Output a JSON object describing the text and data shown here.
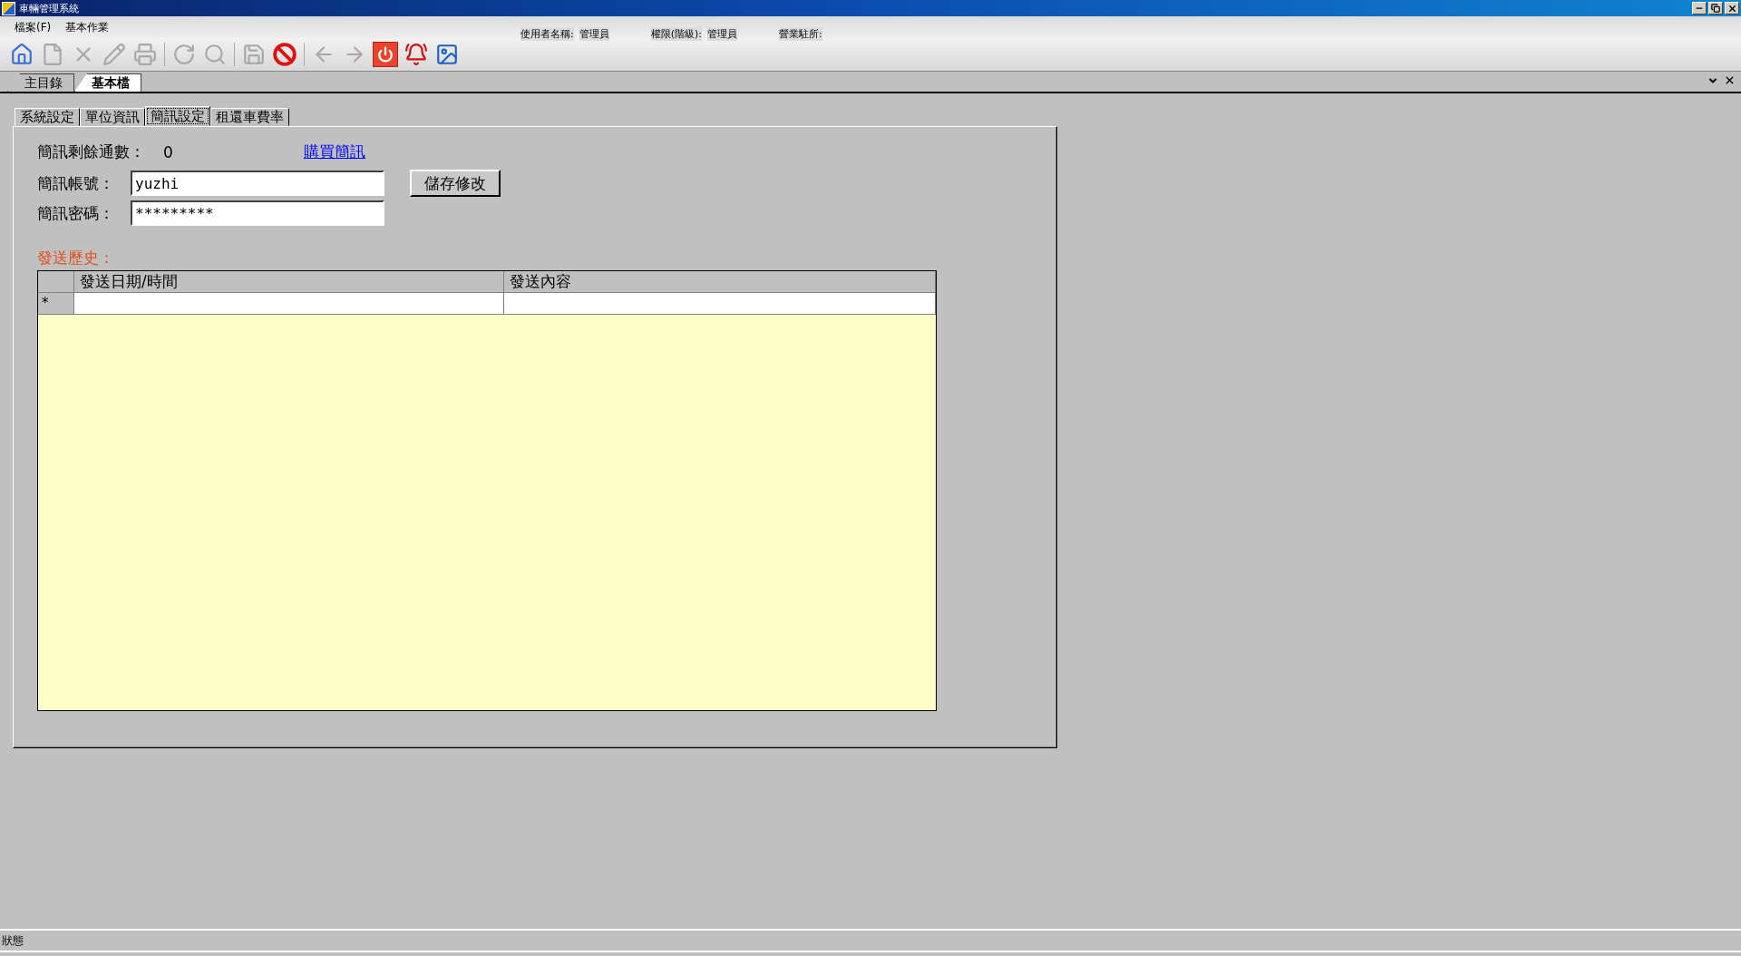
{
  "window": {
    "title": "車輛管理系統"
  },
  "menu": [
    "檔案(F)",
    "基本作業"
  ],
  "user_info": [
    {
      "label": "使用者名稱:",
      "value": "管理員"
    },
    {
      "label": "權限(階級):",
      "value": "管理員"
    },
    {
      "label": "營業駐所:"
    }
  ],
  "toolbar": [
    [
      {
        "kind": "home",
        "disabled": false
      },
      {
        "kind": "new",
        "disabled": true
      },
      {
        "kind": "delete",
        "disabled": true
      },
      {
        "kind": "edit",
        "disabled": true
      },
      {
        "kind": "print",
        "disabled": true
      }
    ],
    [
      {
        "kind": "refresh",
        "disabled": true
      },
      {
        "kind": "search",
        "disabled": true
      }
    ],
    [
      {
        "kind": "save",
        "disabled": true
      },
      {
        "kind": "stop",
        "disabled": false
      }
    ],
    [
      {
        "kind": "back",
        "disabled": true
      },
      {
        "kind": "forward",
        "disabled": true
      },
      {
        "kind": "power",
        "disabled": false
      },
      {
        "kind": "alarm",
        "disabled": false
      },
      {
        "kind": "picture",
        "disabled": false
      }
    ]
  ],
  "document_tabs": [
    {
      "label": "主目錄",
      "selected": false
    },
    {
      "label": "基本檔",
      "selected": true
    }
  ],
  "tabs": [
    {
      "label": "系統設定",
      "selected": false
    },
    {
      "label": "單位資訊",
      "selected": false
    },
    {
      "label": "簡訊設定",
      "selected": true
    },
    {
      "label": "租還車費率",
      "selected": false
    }
  ],
  "sms": {
    "remaining_label": "簡訊剩餘通數：",
    "remaining": "0",
    "buy_link": "購買簡訊",
    "account_label": "簡訊帳號：",
    "account": "yuzhi",
    "password_label": "簡訊密碼：",
    "password": "*********",
    "save_button": "儲存修改"
  },
  "history": {
    "title": "發送歷史：",
    "columns": [
      "發送日期/時間",
      "發送內容"
    ],
    "new_row_marker": "*"
  },
  "status_bar": "狀態"
}
